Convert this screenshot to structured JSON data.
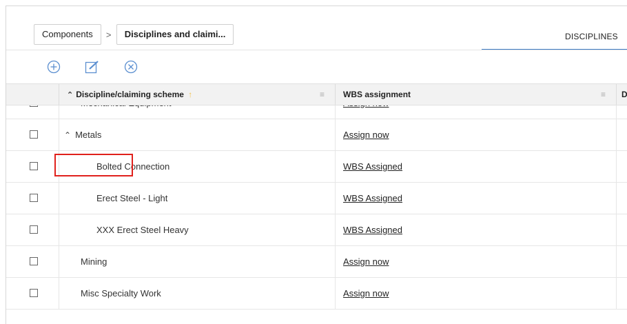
{
  "breadcrumb": {
    "items": [
      "Components",
      "Disciplines and claimi..."
    ],
    "separator": ">"
  },
  "tabs": {
    "disciplines": "DISCIPLINES"
  },
  "toolbar": {
    "add_icon": "add-circle-icon",
    "edit_icon": "edit-icon",
    "delete_icon": "close-circle-icon"
  },
  "grid": {
    "columns": {
      "discipline": "Discipline/claiming scheme",
      "wbs": "WBS assignment",
      "next": "D"
    },
    "rows": [
      {
        "name": "Mechanical Equipment",
        "wbs": "Assign now"
      },
      {
        "name": "Metals",
        "wbs": "Assign now",
        "expanded": true
      },
      {
        "name": "Bolted Connection",
        "wbs": "WBS Assigned"
      },
      {
        "name": "Erect Steel - Light",
        "wbs": "WBS Assigned"
      },
      {
        "name": "XXX Erect Steel Heavy",
        "wbs": "WBS Assigned"
      },
      {
        "name": "Mining",
        "wbs": "Assign now"
      },
      {
        "name": "Misc Specialty Work",
        "wbs": "Assign now"
      }
    ]
  },
  "colors": {
    "accent": "#3b7ac4",
    "highlight": "#e0201b",
    "sort": "#f0c24a"
  }
}
